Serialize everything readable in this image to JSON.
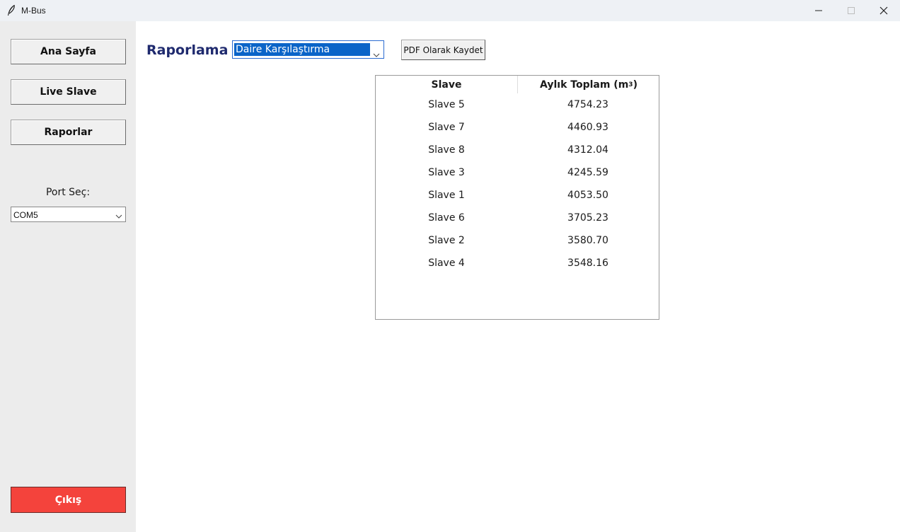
{
  "window": {
    "title": "M-Bus"
  },
  "sidebar": {
    "nav": [
      {
        "label": "Ana Sayfa"
      },
      {
        "label": "Live Slave"
      },
      {
        "label": "Raporlar"
      }
    ],
    "port_label": "Port Seç:",
    "port_value": "COM5",
    "exit_label": "Çıkış"
  },
  "main": {
    "heading": "Raporlama",
    "report_type": "Daire Karşılaştırma",
    "pdf_button": "PDF Olarak Kaydet",
    "table": {
      "col_slave": "Slave",
      "col_total": "Aylık Toplam (m",
      "col_total_sup": "3",
      "col_total_close": ")",
      "rows": [
        {
          "slave": "Slave 5",
          "total": "4754.23"
        },
        {
          "slave": "Slave 7",
          "total": "4460.93"
        },
        {
          "slave": "Slave 8",
          "total": "4312.04"
        },
        {
          "slave": "Slave 3",
          "total": "4245.59"
        },
        {
          "slave": "Slave 1",
          "total": "4053.50"
        },
        {
          "slave": "Slave 6",
          "total": "3705.23"
        },
        {
          "slave": "Slave 2",
          "total": "3580.70"
        },
        {
          "slave": "Slave 4",
          "total": "3548.16"
        }
      ]
    }
  },
  "colors": {
    "heading": "#1f2a6e",
    "exit_bg": "#f4433c",
    "selection": "#0a64c8"
  }
}
